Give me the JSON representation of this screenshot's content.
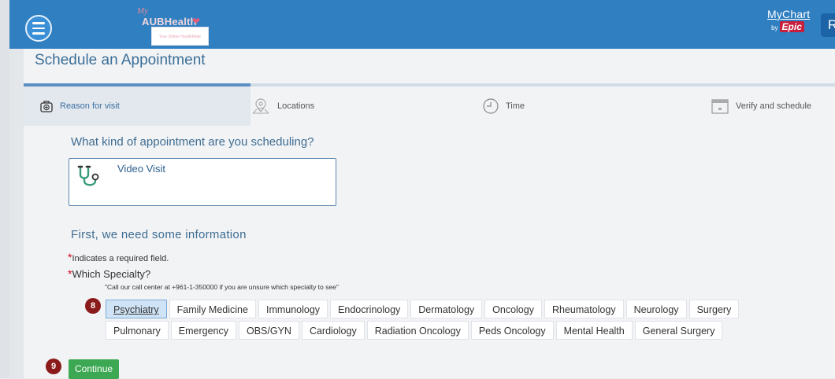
{
  "header": {
    "logo": {
      "prefix": "My",
      "name": "AUBHealth",
      "tagline": "Your Online HealthMate"
    },
    "mychart": {
      "title": "MyChart",
      "by": "by",
      "brand": "Epic"
    },
    "user_initial": "R"
  },
  "page": {
    "title": "Schedule an Appointment",
    "progress_fraction": 0.28
  },
  "steps": [
    {
      "label": "Reason for visit",
      "active": true,
      "icon": "medical-bag-icon"
    },
    {
      "label": "Locations",
      "active": false,
      "icon": "map-pin-icon"
    },
    {
      "label": "Time",
      "active": false,
      "icon": "clock-icon"
    },
    {
      "label": "Verify and schedule",
      "active": false,
      "icon": "calendar-icon"
    }
  ],
  "appointment": {
    "heading": "What kind of appointment are you scheduling?",
    "selected_type": "Video Visit",
    "selected_icon": "stethoscope-icon"
  },
  "form": {
    "heading": "First, we need some information",
    "required_note": "Indicates a required field.",
    "required_marker": "*",
    "specialty_label": "Which Specialty?",
    "specialty_note": "\"Call our call center at +961-1-350000 if you are unsure which specialty to see\"",
    "specialties_row1": [
      "Psychiatry",
      "Family Medicine",
      "Immunology",
      "Endocrinology",
      "Dermatology",
      "Oncology",
      "Rheumatology",
      "Neurology",
      "Surgery"
    ],
    "specialties_row2": [
      "Pulmonary",
      "Emergency",
      "OBS/GYN",
      "Cardiology",
      "Radiation Oncology",
      "Peds Oncology",
      "Mental Health",
      "General Surgery"
    ],
    "selected_specialty": "Psychiatry"
  },
  "annotations": {
    "specialty_badge": "8",
    "continue_badge": "9"
  },
  "actions": {
    "continue_label": "Continue"
  },
  "colors": {
    "header": "#2f7fc1",
    "accent": "#3e6d92",
    "continue": "#3ca853",
    "required": "#d0021b",
    "badge": "#8b1a1a"
  }
}
